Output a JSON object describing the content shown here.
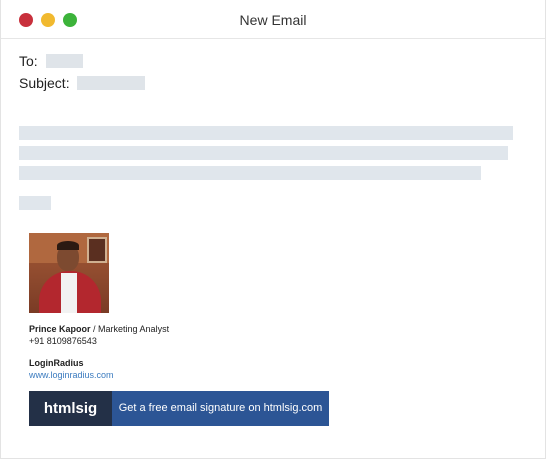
{
  "window": {
    "title": "New Email",
    "controls": [
      {
        "name": "close",
        "color": "#c8303c"
      },
      {
        "name": "minimize",
        "color": "#f1b92f"
      },
      {
        "name": "zoom",
        "color": "#3cb33a"
      }
    ]
  },
  "fields": {
    "to_label": "To:",
    "subject_label": "Subject:"
  },
  "signature": {
    "name": "Prince Kapoor",
    "separator": " / ",
    "role": "Marketing Analyst",
    "phone": "+91 8109876543",
    "company": "LoginRadius",
    "website": "www.loginradius.com"
  },
  "banner": {
    "brand": "htmlsig",
    "cta": "Get a free email signature on htmlsig.com",
    "brand_color": "#233047",
    "cta_color": "#2c5595"
  }
}
